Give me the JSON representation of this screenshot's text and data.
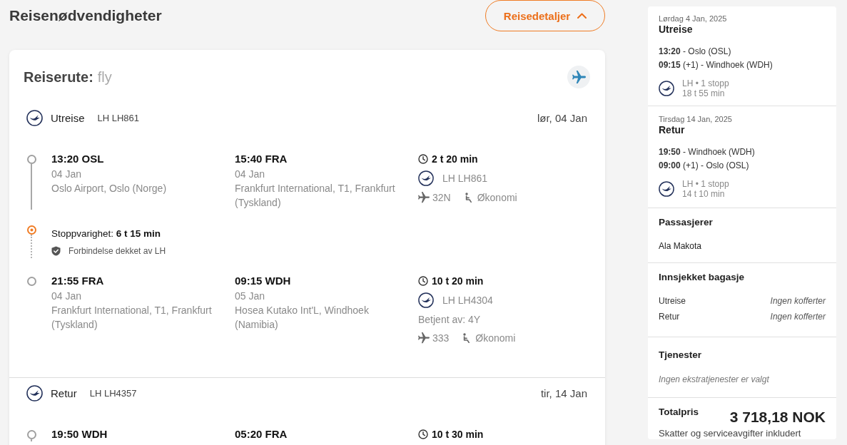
{
  "header": {
    "title": "Reisenødvendigheter",
    "details_button": {
      "label": "Reisedetaljer",
      "expanded": true
    }
  },
  "itinerary": {
    "label": "Reiserute:",
    "mode": "fly",
    "segments": [
      {
        "direction": "Utreise",
        "flight": "LH LH861",
        "date": "lør, 04 Jan",
        "items": [
          {
            "kind": "leg",
            "departure": {
              "time": "13:20 OSL",
              "date": "04 Jan",
              "place": "Oslo Airport, Oslo (Norge)"
            },
            "arrival": {
              "time": "15:40 FRA",
              "date": "04 Jan",
              "place": "Frankfurt International, T1, Frankfurt (Tyskland)"
            },
            "duration": "2 t 20 min",
            "flight": "LH LH861",
            "aircraft": "32N",
            "cabin": "Økonomi"
          },
          {
            "kind": "stop",
            "text": "Stoppvarighet: **6 t 15 min**",
            "note": "Forbindelse dekket av LH"
          },
          {
            "kind": "leg",
            "departure": {
              "time": "21:55 FRA",
              "date": "04 Jan",
              "place": "Frankfurt International, T1, Frankfurt (Tyskland)"
            },
            "arrival": {
              "time": "09:15 WDH",
              "date": "05 Jan",
              "place": "Hosea Kutako Int'L, Windhoek (Namibia)"
            },
            "duration": "10 t 20 min",
            "flight": "LH LH4304",
            "operated_by": "Betjent av: 4Y",
            "aircraft": "333",
            "cabin": "Økonomi"
          }
        ]
      },
      {
        "direction": "Retur",
        "flight": "LH LH4357",
        "date": "tir, 14 Jan",
        "items": [
          {
            "kind": "leg",
            "departure": {
              "time": "19:50 WDH"
            },
            "arrival": {
              "time": "05:20 FRA"
            },
            "duration": "10 t 30 min"
          }
        ]
      }
    ]
  },
  "summary": {
    "trips": [
      {
        "date": "Lørdag 4 Jan, 2025",
        "title": "Utreise",
        "departure": "**13:20** - Oslo (OSL)",
        "arrival": "**09:15** (+1) - Windhoek (WDH)",
        "carrier": "LH • 1 stopp",
        "duration": "18 t 55 min"
      },
      {
        "date": "Tirsdag 14 Jan, 2025",
        "title": "Retur",
        "departure": "**19:50** - Windhoek (WDH)",
        "arrival": "**09:00** (+1) - Oslo (OSL)",
        "carrier": "LH • 1 stopp",
        "duration": "14 t 10 min"
      }
    ],
    "passengers": {
      "title": "Passasjerer",
      "names": [
        "Ala Makota"
      ]
    },
    "baggage": {
      "title": "Innsjekket bagasje",
      "rows": [
        {
          "label": "Utreise",
          "value": "Ingen kofferter"
        },
        {
          "label": "Retur",
          "value": "Ingen kofferter"
        }
      ]
    },
    "services": {
      "title": "Tjenester",
      "empty_text": "Ingen ekstratjenester er valgt"
    },
    "total": {
      "label": "Totalpris",
      "amount": "3 718,18 NOK",
      "note": "Skatter og serviceavgifter inkludert"
    }
  }
}
